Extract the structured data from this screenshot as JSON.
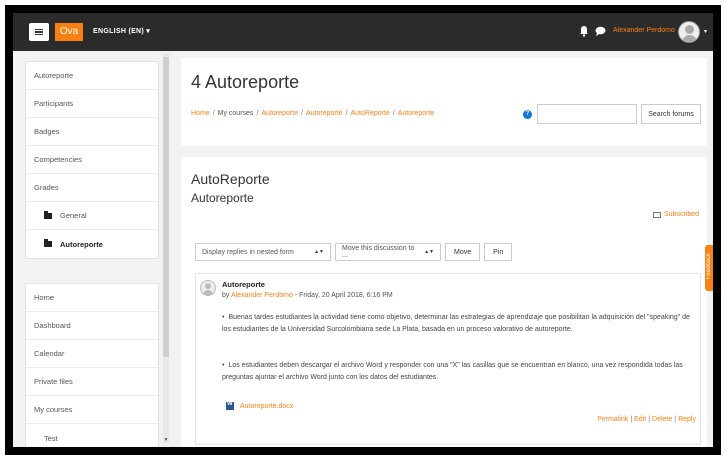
{
  "navbar": {
    "brand": "Ova",
    "language": "ENGLISH (EN) ▾",
    "username": "Alexander Perdomo",
    "caret": "▾"
  },
  "sidebar": {
    "course_items": [
      {
        "label": "Autoreporte"
      },
      {
        "label": "Participants"
      },
      {
        "label": "Badges"
      },
      {
        "label": "Competencies"
      },
      {
        "label": "Grades"
      },
      {
        "label": "General"
      },
      {
        "label": "Autoreporte"
      }
    ],
    "site_items": [
      {
        "label": "Home"
      },
      {
        "label": "Dashboard"
      },
      {
        "label": "Calendar"
      },
      {
        "label": "Private files"
      },
      {
        "label": "My courses"
      },
      {
        "label": "Test"
      }
    ]
  },
  "header": {
    "title": "4 Autoreporte",
    "breadcrumb": [
      "Home",
      "My courses",
      "Autoreporte",
      "Autoreporte",
      "AutoReporte",
      "Autoreporte"
    ],
    "search_button": "Search forums",
    "search_placeholder": ""
  },
  "discussion": {
    "title": "AutoReporte",
    "subtitle": "Autoreporte",
    "subscribed": "Subscribed",
    "display_mode": "Display replies in nested form",
    "move_select": "Move this discussion to ...",
    "move_button": "Move",
    "pin_button": "Pin"
  },
  "post": {
    "subject": "Autoreporte",
    "by": "by",
    "author": "Alexander Perdomo",
    "date": " - Friday, 20 April 2018, 6:16 PM",
    "paragraphs": [
      "Buenas tardes estudiantes la actividad tiene como objetivo, determinar las estrategias de aprendizaje que posibilitan la adquisición del \"speaking\" de los estudiantes de la Universidad Surcolombiana sede La Plata, basada en un proceso valorativo de autoreporte.",
      "Los estudiantes deben descargar el archivo Word y responder con una \"X\" las casillas que se encuentran en blanco, una vez respondida todas las preguntas ajuntar el archivo Word junto con los datos del estudiantes."
    ],
    "attachment": "Autoreporte.docx",
    "actions": [
      "Permalink",
      "Edit",
      "Delete",
      "Reply"
    ]
  },
  "feedback": {
    "label": "Feedback"
  },
  "colors": {
    "accent": "#f98012",
    "navbar": "#2b2b2b",
    "link_blue": "#1177d1"
  }
}
